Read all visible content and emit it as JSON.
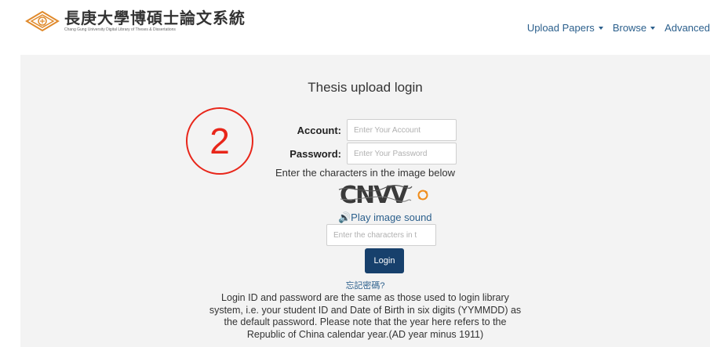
{
  "header": {
    "logo_cn": "長庚大學博碩士論文系統",
    "logo_en": "Chang Gung University Digital Library of Theses & Dissertations",
    "nav": [
      {
        "label": "Upload Papers"
      },
      {
        "label": "Browse"
      },
      {
        "label": "Advanced"
      }
    ]
  },
  "login": {
    "title": "Thesis upload login",
    "account_label": "Account:",
    "account_placeholder": "Enter Your Account",
    "password_label": "Password:",
    "password_placeholder": "Enter Your Password",
    "captcha_prompt": "Enter the characters in the image below",
    "captcha_text": "CNVV",
    "sound_label": "🔊Play image sound",
    "captcha_placeholder": "Enter the characters in t",
    "login_button": "Login",
    "forgot_link": "忘記密碼?",
    "note_lines": [
      "Login ID and password are the same as those used to login library",
      "system, i.e. your student ID and Date of Birth in six digits (YYMMDD) as",
      "the default password. Please note that the year here refers to the",
      "Republic of China calendar year.(AD year minus 1911)"
    ]
  },
  "annotation": {
    "number": "2",
    "color": "#e8261a"
  },
  "colors": {
    "link": "#2b5f8c",
    "button": "#17406c",
    "panel": "#f3f3f3"
  }
}
